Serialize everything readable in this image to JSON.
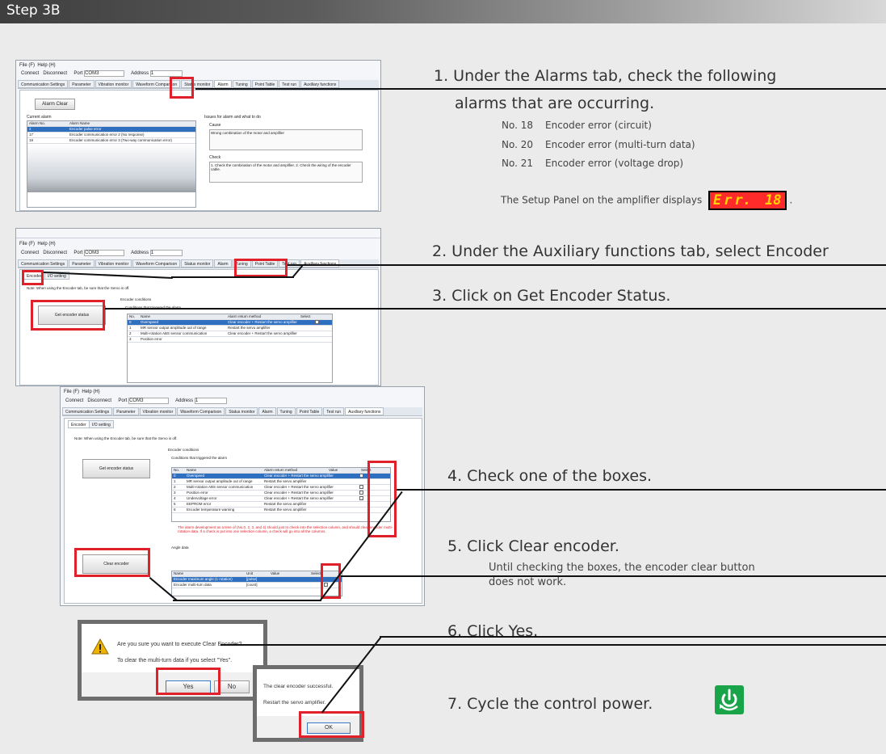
{
  "header": {
    "title": "Step 3B"
  },
  "steps": [
    {
      "label": "1. Under the Alarms tab, check the following"
    },
    {
      "label": "alarms that are occurring."
    },
    {
      "label": "2. Under the Auxiliary functions tab, select Encoder"
    },
    {
      "label": "3. Click on Get Encoder Status."
    },
    {
      "label": "4. Check one of the boxes."
    },
    {
      "label": "5. Click Clear encoder."
    },
    {
      "label": "6. Click Yes."
    },
    {
      "label": "7. Cycle the control power."
    }
  ],
  "alarm_list": [
    {
      "no": "No. 18",
      "desc": "Encoder error (circuit)"
    },
    {
      "no": "No. 20",
      "desc": "Encoder error (multi-turn data)"
    },
    {
      "no": "No. 21",
      "desc": "Encoder error (voltage drop)"
    }
  ],
  "setup_panel": {
    "prefix": "The Setup Panel on the amplifier displays",
    "display": [
      "E",
      "r",
      "r.",
      "18"
    ],
    "suffix": "."
  },
  "step5_note": {
    "line1": "Until checking the boxes, the encoder clear button",
    "line2": "does not work."
  },
  "app": {
    "menu_file": "File (F)",
    "menu_help": "Help (H)",
    "connect": "Connect",
    "disconnect": "Disconnect",
    "port_label": "Port",
    "port_value": "COM3",
    "address_label": "Address",
    "address_value": "1",
    "tabs": [
      "Communication Settings",
      "Parameter",
      "Vibration monitor",
      "Waveform Comparison",
      "Status monitor",
      "Alarm",
      "Tuning",
      "Point Table",
      "Test run",
      "Auxiliary functions"
    ],
    "alarm_clear": "Alarm Clear",
    "current_alarm": "Current alarm",
    "alarm_head": [
      "Alarm No.",
      "Alarm Name"
    ],
    "alarm_rows": [
      {
        "no": "2",
        "name": "Encoder pulse error",
        "selected": true
      },
      {
        "no": "17",
        "name": "Encoder communication error 2 (No response)"
      },
      {
        "no": "18",
        "name": "Encoder communication error 3 (Two-way communication error)"
      }
    ],
    "cause_title": "Issues for alarm and what to do",
    "cause_label": "Cause",
    "cause_text": "Wrong combination of the motor and amplifier",
    "check_label": "Check",
    "check_text": "1. Check the combination of the motor and amplifier. 2. Check the wiring of the encoder cable.",
    "subtab_encoder": "Encoder",
    "subtab_io": "I/O setting",
    "aux_note": "Note: When using the Encoder tab, be sure that the Servo is off.",
    "get_status": "Get encoder status",
    "conditions_title": "Encoder conditions",
    "conditions_sub": "Conditions that triggered the alarm",
    "cond_head": [
      "No.",
      "Name",
      "Alarm return method",
      "Value",
      "Select"
    ],
    "cond_rows": [
      {
        "no": "0",
        "name": "Overspeed",
        "method": "Clear encoder + Restart the servo amplifier",
        "selected": true
      },
      {
        "no": "1",
        "name": "MR sensor output amplitude out of range",
        "method": "Restart the servo amplifier"
      },
      {
        "no": "2",
        "name": "Multi-rotation ABS sensor communication",
        "method": "Clear encoder + Restart the servo amplifier"
      },
      {
        "no": "3",
        "name": "Position error",
        "method": "Clear encoder + Restart the servo amplifier"
      },
      {
        "no": "4",
        "name": "Undervoltage error",
        "method": "Clear encoder + Restart the servo amplifier"
      },
      {
        "no": "5",
        "name": "EEPROM error",
        "method": "Restart the servo amplifier"
      },
      {
        "no": "6",
        "name": "Encoder temperature warning",
        "method": "Restart the servo amplifier"
      }
    ],
    "warning_text": "The alarm development as a time of (No.0, 2, 3, and 4) should just to check into the selection column, and should clear encoder multi-rotation data. If a check is put into one selection column, a check will go into all the columns.",
    "angle_title": "Angle data",
    "angle_head": [
      "Name",
      "Unit",
      "Value",
      "Select"
    ],
    "angle_rows": [
      {
        "name": "Encoder maximum angle (1 rotation)",
        "unit": "[pulse]",
        "selected": true
      },
      {
        "name": "Encoder multi-turn data",
        "unit": "[count]"
      }
    ],
    "clear_encoder": "Clear encoder"
  },
  "confirm_dialog": {
    "question": "Are you sure you want to execute Clear Encoder?",
    "detail": "To clear the multi-turn data if you select \"Yes\".",
    "yes": "Yes",
    "no": "No"
  },
  "result_dialog": {
    "line1": "The clear encoder successful.",
    "line2": "Restart the servo amplifier.",
    "ok": "OK"
  },
  "colors": {
    "highlight": "#e0202a",
    "power_icon": "#1aa44a",
    "selection": "#2f6fc0"
  },
  "icons": {
    "warning": "warning-icon",
    "power": "power-cycle-icon"
  }
}
